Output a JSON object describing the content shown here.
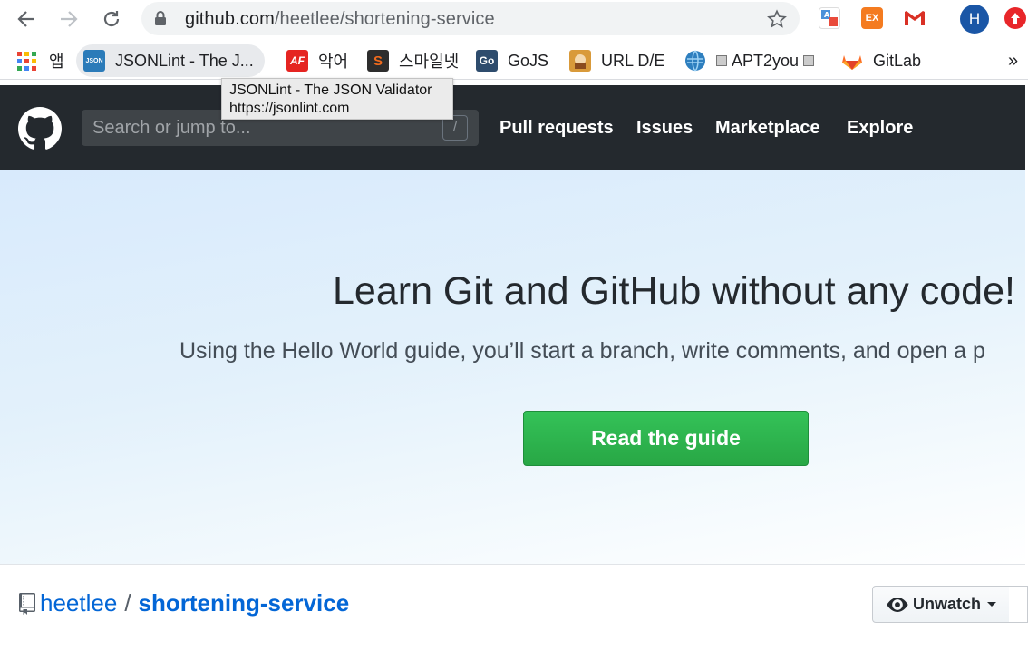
{
  "browser": {
    "url_host": "github.com",
    "url_path": "/heetlee/shortening-service",
    "avatar_letter": "H",
    "extensions": [
      {
        "name": "translate-extension-icon"
      },
      {
        "name": "ex-extension-icon",
        "label": "EX",
        "color": "#f47b20"
      },
      {
        "name": "gmail-icon"
      },
      {
        "name": "update-icon",
        "color": "#e8262a"
      }
    ]
  },
  "bookmarks": {
    "apps_label": "앱",
    "items": [
      {
        "label": "JSONLint - The J...",
        "icon": "JSON",
        "color": "#2b7bb9"
      },
      {
        "label": "악어",
        "icon": "AF",
        "color": "#e52421"
      },
      {
        "label": "스마일넷",
        "icon": "S",
        "color": "#2d2d2d"
      },
      {
        "label": "GoJS",
        "icon": "Go",
        "color": "#2e4c6d"
      },
      {
        "label": "URL D/E",
        "icon": "url-de-icon",
        "color": "#d99a3a"
      },
      {
        "label": "APT2you",
        "icon": "globe-icon",
        "color": "#2e7fbf"
      },
      {
        "label": "GitLab",
        "icon": "gitlab-icon",
        "color": "#e24329"
      }
    ],
    "overflow": "»"
  },
  "tooltip": {
    "title": "JSONLint - The JSON Validator",
    "url": "https://jsonlint.com"
  },
  "github": {
    "search_placeholder": "Search or jump to...",
    "search_shortcut": "/",
    "nav": [
      "Pull requests",
      "Issues",
      "Marketplace",
      "Explore"
    ]
  },
  "hero": {
    "title": "Learn Git and GitHub without any code!",
    "subtitle": "Using the Hello World guide, you’ll start a branch, write comments, and open a p",
    "button": "Read the guide"
  },
  "repo": {
    "owner": "heetlee",
    "separator": "/",
    "name": "shortening-service",
    "watch_label": "Unwatch"
  }
}
